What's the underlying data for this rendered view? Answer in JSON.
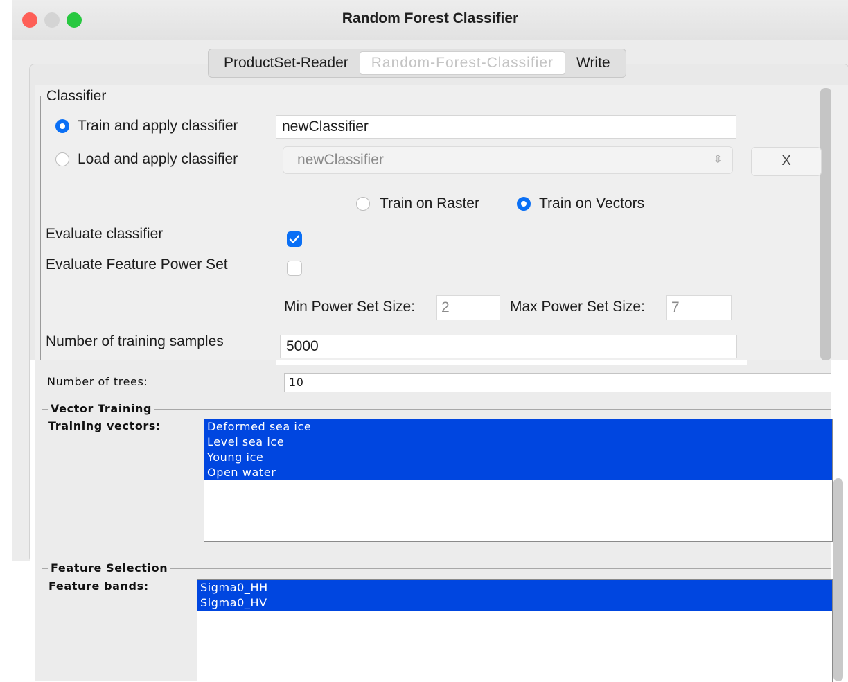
{
  "window": {
    "title": "Random Forest Classifier"
  },
  "tabs": [
    {
      "label": "ProductSet-Reader",
      "selected": false
    },
    {
      "label": "Random-Forest-Classifier",
      "selected": true
    },
    {
      "label": "Write",
      "selected": false
    }
  ],
  "classifier": {
    "section_title": "Classifier",
    "train_apply_label": "Train and apply classifier",
    "train_apply_value": "newClassifier",
    "load_apply_label": "Load and apply classifier",
    "load_apply_value": "newClassifier",
    "remove_button": "X",
    "train_on_raster_label": "Train on Raster",
    "train_on_vectors_label": "Train on Vectors",
    "evaluate_label": "Evaluate classifier",
    "evaluate_checked": true,
    "evaluate_power_label": "Evaluate Feature Power Set",
    "evaluate_power_checked": false,
    "min_power_label": "Min Power Set Size:",
    "min_power_value": "2",
    "max_power_label": "Max Power Set Size:",
    "max_power_value": "7",
    "num_samples_label": "Number of training samples",
    "num_samples_value": "5000",
    "num_trees_label": "Number of trees:",
    "num_trees_value": "10"
  },
  "vector_training": {
    "section_title": "Vector Training",
    "label": "Training vectors:",
    "items": [
      "Deformed sea ice",
      "Level sea ice",
      "Young ice",
      "Open water"
    ]
  },
  "feature_selection": {
    "section_title": "Feature Selection",
    "label": "Feature bands:",
    "items": [
      "Sigma0_HH",
      "Sigma0_HV"
    ]
  },
  "colors": {
    "accent": "#0a6ff5",
    "selection": "#0046e0"
  }
}
